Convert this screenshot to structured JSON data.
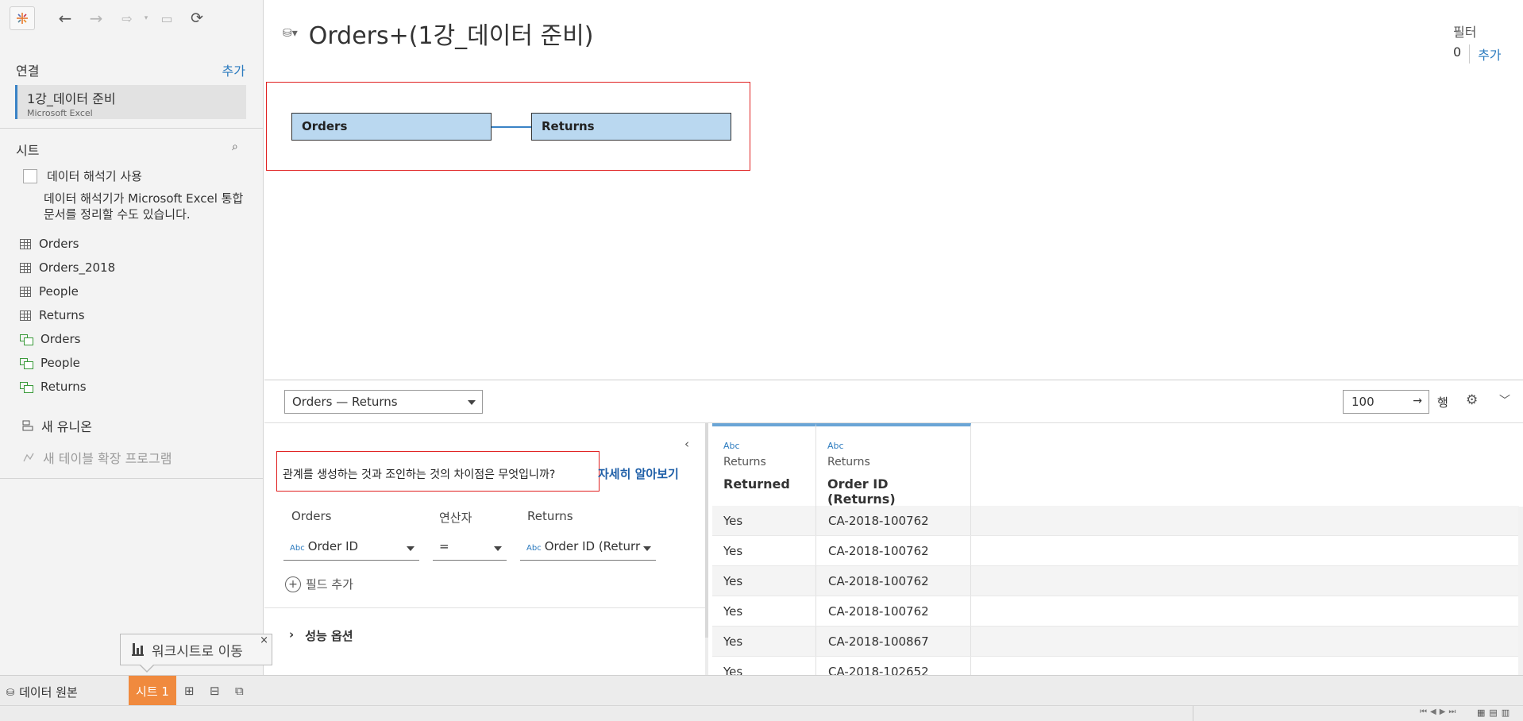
{
  "connections": {
    "title": "연결",
    "add_label": "추가",
    "items": [
      {
        "name": "1강_데이터 준비",
        "type": "Microsoft Excel"
      }
    ]
  },
  "sheets": {
    "title": "시트",
    "interpreter_label": "데이터 해석기 사용",
    "interpreter_hint": "데이터 해석기가 Microsoft Excel 통합 문서를 정리할 수도 있습니다.",
    "items": [
      {
        "label": "Orders",
        "icon": "table-icon"
      },
      {
        "label": "Orders_2018",
        "icon": "table-icon"
      },
      {
        "label": "People",
        "icon": "table-icon"
      },
      {
        "label": "Returns",
        "icon": "table-icon"
      },
      {
        "label": "Orders",
        "icon": "named-range-icon"
      },
      {
        "label": "People",
        "icon": "named-range-icon"
      },
      {
        "label": "Returns",
        "icon": "named-range-icon"
      }
    ],
    "new_union": "새 유니온",
    "new_extension": "새 테이블 확장 프로그램"
  },
  "main": {
    "title": "Orders+(1강_데이터 준비)",
    "filter_label": "필터",
    "filter_count": "0",
    "filter_add": "추가"
  },
  "canvas": {
    "left_table": "Orders",
    "right_table": "Returns"
  },
  "relationship": {
    "selector": "Orders  —  Returns",
    "rows_value": "100",
    "rows_label": "행",
    "question": "관계를 생성하는 것과 조인하는 것의 차이점은 무엇입니까?",
    "learn_more": "자세히 알아보기",
    "col_left": "Orders",
    "col_op": "연산자",
    "col_right": "Returns",
    "left_field": "Order ID",
    "operator": "=",
    "right_field": "Order ID (Returr",
    "add_field": "필드 추가",
    "performance": "성능 옵션",
    "abc": "Abc"
  },
  "grid": {
    "columns": [
      {
        "type": "Abc",
        "source": "Returns",
        "field": "Returned"
      },
      {
        "type": "Abc",
        "source": "Returns",
        "field": "Order ID (Returns)"
      }
    ],
    "rows": [
      [
        "Yes",
        "CA-2018-100762"
      ],
      [
        "Yes",
        "CA-2018-100762"
      ],
      [
        "Yes",
        "CA-2018-100762"
      ],
      [
        "Yes",
        "CA-2018-100762"
      ],
      [
        "Yes",
        "CA-2018-100867"
      ],
      [
        "Yes",
        "CA-2018-102652"
      ]
    ]
  },
  "tooltip": {
    "label": "워크시트로 이동",
    "close": "×"
  },
  "bottom": {
    "datasource_tab": "데이터 원본",
    "sheet_tab": "시트 1"
  },
  "colors": {
    "accent": "#2c7bbf",
    "table_fill": "#bad8f0",
    "sheet_tab": "#f08a3e",
    "highlight": "#e02020"
  }
}
